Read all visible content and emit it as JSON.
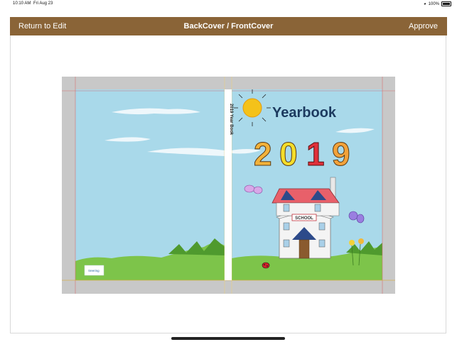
{
  "status_bar": {
    "time": "10:10 AM",
    "date": "Fri Aug 23",
    "battery": "100%"
  },
  "navbar": {
    "back_label": "Return to Edit",
    "title": "BackCover / FrontCover",
    "approve_label": "Approve"
  },
  "cover": {
    "spine_text": "2019 Year Book",
    "front_title": "Yearbook",
    "year": "2019",
    "school_sign": "SCHOOL",
    "logo_text": "treering"
  },
  "colors": {
    "toolbar": "#8a6437",
    "sky": "#a9d9ea",
    "grass": "#7dc44a",
    "bleed": "#c8c8c8"
  }
}
